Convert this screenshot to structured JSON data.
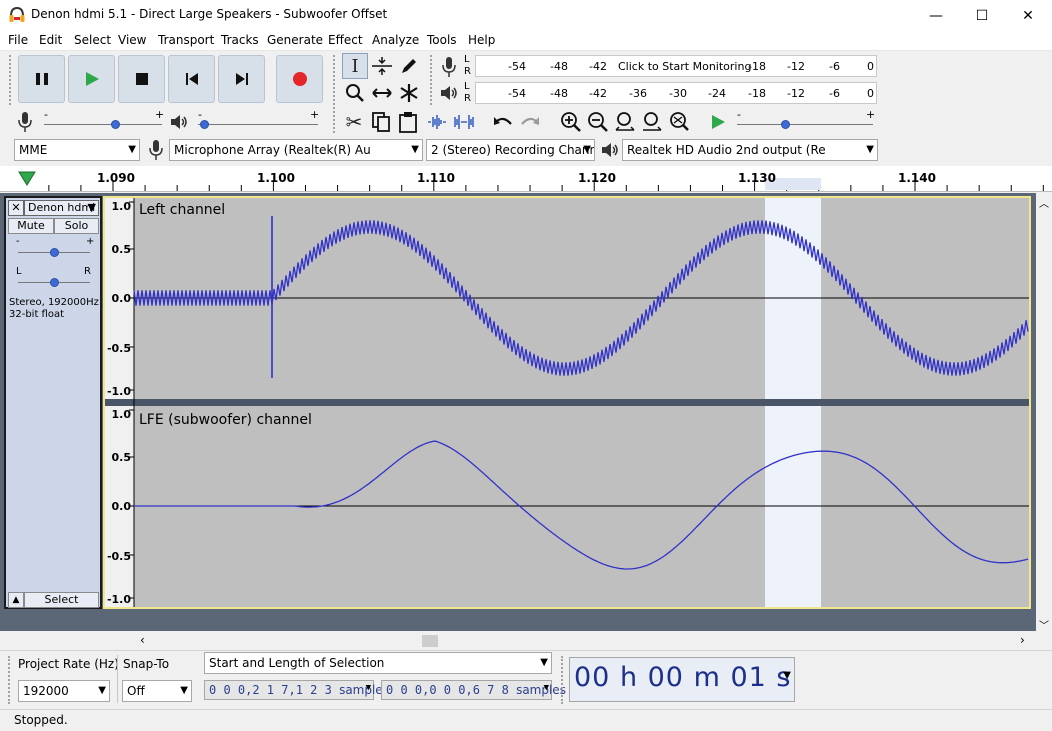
{
  "window": {
    "title": "Denon hdmi 5.1 - Direct Large Speakers - Subwoofer Offset",
    "minimize_glyph": "—",
    "maximize_glyph": "☐",
    "close_glyph": "✕"
  },
  "menu": [
    "File",
    "Edit",
    "Select",
    "View",
    "Transport",
    "Tracks",
    "Generate",
    "Effect",
    "Analyze",
    "Tools",
    "Help"
  ],
  "meters": {
    "record_letters": [
      "L",
      "R"
    ],
    "record_ticks": [
      "-54",
      "-48",
      "-42",
      "-18",
      "-12",
      "-6",
      "0"
    ],
    "record_hint": "Click to Start Monitoring",
    "playback_letters": [
      "L",
      "R"
    ],
    "playback_ticks": [
      "-54",
      "-48",
      "-42",
      "-36",
      "-30",
      "-24",
      "-18",
      "-12",
      "-6",
      "0"
    ]
  },
  "mixer": {
    "rec_minus": "-",
    "rec_plus": "+",
    "play_minus": "-",
    "play_plus": "+",
    "rec_level": 0.6,
    "play_level": 0.05,
    "speed_level": 0.35
  },
  "device": {
    "host": "MME",
    "input": "Microphone Array (Realtek(R) Au",
    "channels": "2 (Stereo) Recording Chann",
    "output": "Realtek HD Audio 2nd output (Re"
  },
  "ruler": {
    "labels": [
      "1.090",
      "1.100",
      "1.110",
      "1.120",
      "1.130",
      "1.140"
    ]
  },
  "track": {
    "name": "Denon hdmi",
    "mute": "Mute",
    "solo": "Solo",
    "gain_minus": "-",
    "gain_plus": "+",
    "pan_left": "L",
    "pan_right": "R",
    "info_line1": "Stereo, 192000Hz",
    "info_line2": "32-bit float",
    "select": "Select",
    "channels": [
      {
        "label": "Left channel",
        "scale": [
          "1.0",
          "0.5",
          "0.0",
          "-0.5",
          "-1.0"
        ]
      },
      {
        "label": "LFE (subwoofer) channel",
        "scale": [
          "1.0",
          "0.5",
          "0.0",
          "-0.5",
          "-1.0"
        ]
      }
    ]
  },
  "selection": {
    "rate_label": "Project Rate (Hz)",
    "snap_label": "Snap-To",
    "rate_value": "192000",
    "snap_value": "Off",
    "mode": "Start and Length of Selection",
    "start": "0 0 0,2 1 7,1 2 3",
    "start_unit": "samples",
    "length": "0 0 0,0 0 0,6 7 8",
    "length_unit": "samples",
    "time": "00 h 00 m 01 s"
  },
  "status": "Stopped.",
  "colors": {
    "waveform": "#3232c8",
    "selection": "#eef2fb",
    "track_bg": "#bfbfbf",
    "accent": "#2b6fd6"
  }
}
